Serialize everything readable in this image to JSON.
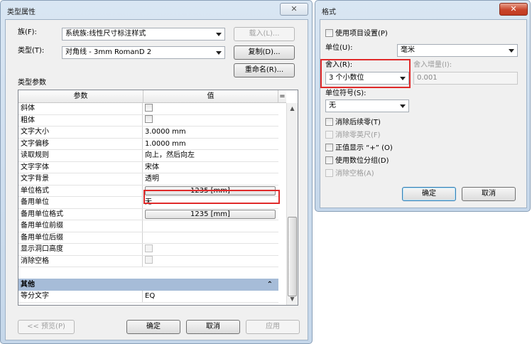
{
  "type_properties": {
    "title": "类型属性",
    "close_glyph": "✕",
    "family_label": "族(F):",
    "family_value": "系统族:线性尺寸标注样式",
    "type_label": "类型(T):",
    "type_value": "对角线 - 3mm RomanD 2",
    "load_button": "载入(L)...",
    "duplicate_button": "复制(D)...",
    "rename_button": "重命名(R)...",
    "params_section_label": "类型参数",
    "col_param": "参数",
    "col_value": "值",
    "col_menu_glyph": "=",
    "rows": [
      {
        "param": "斜体",
        "value": "",
        "kind": "check"
      },
      {
        "param": "粗体",
        "value": "",
        "kind": "check"
      },
      {
        "param": "文字大小",
        "value": "3.0000 mm",
        "kind": "text"
      },
      {
        "param": "文字偏移",
        "value": "1.0000 mm",
        "kind": "text"
      },
      {
        "param": "读取规则",
        "value": "向上，然后向左",
        "kind": "text"
      },
      {
        "param": "文字字体",
        "value": "宋体",
        "kind": "text"
      },
      {
        "param": "文字背景",
        "value": "透明",
        "kind": "text"
      },
      {
        "param": "单位格式",
        "value": "1235 [mm]",
        "kind": "button"
      },
      {
        "param": "备用单位",
        "value": "无",
        "kind": "text"
      },
      {
        "param": "备用单位格式",
        "value": "1235 [mm]",
        "kind": "button"
      },
      {
        "param": "备用单位前缀",
        "value": "",
        "kind": "text"
      },
      {
        "param": "备用单位后缀",
        "value": "",
        "kind": "text"
      },
      {
        "param": "显示洞口高度",
        "value": "",
        "kind": "check"
      },
      {
        "param": "消除空格",
        "value": "",
        "kind": "check"
      }
    ],
    "other_section": "其他",
    "other_collapse_glyph": "⌃",
    "other_rows": [
      {
        "param": "等分文字",
        "value": "EQ"
      }
    ],
    "preview_button": "<< 预览(P)",
    "ok_button": "确定",
    "cancel_button": "取消",
    "apply_button": "应用"
  },
  "format_dialog": {
    "title": "格式",
    "close_glyph": "✕",
    "use_project_settings": "使用项目设置(P)",
    "units_label": "单位(U):",
    "units_value": "毫米",
    "rounding_label": "舍入(R):",
    "rounding_value": "3 个小数位",
    "rounding_increment_label": "舍入增量(I):",
    "rounding_increment_value": "0.001",
    "unit_symbol_label": "单位符号(S):",
    "unit_symbol_value": "无",
    "checkboxes": [
      {
        "label": "消除后续零(T)",
        "enabled": true
      },
      {
        "label": "消除零英尺(F)",
        "enabled": false
      },
      {
        "label": "正值显示 “+” (O)",
        "enabled": true
      },
      {
        "label": "使用数位分组(D)",
        "enabled": true
      },
      {
        "label": "消除空格(A)",
        "enabled": false
      }
    ],
    "ok_button": "确定",
    "cancel_button": "取消"
  },
  "colors": {
    "highlight_red": "#e02a2a",
    "section_blue": "#a6bcd8",
    "close_red": "#c8452b"
  }
}
